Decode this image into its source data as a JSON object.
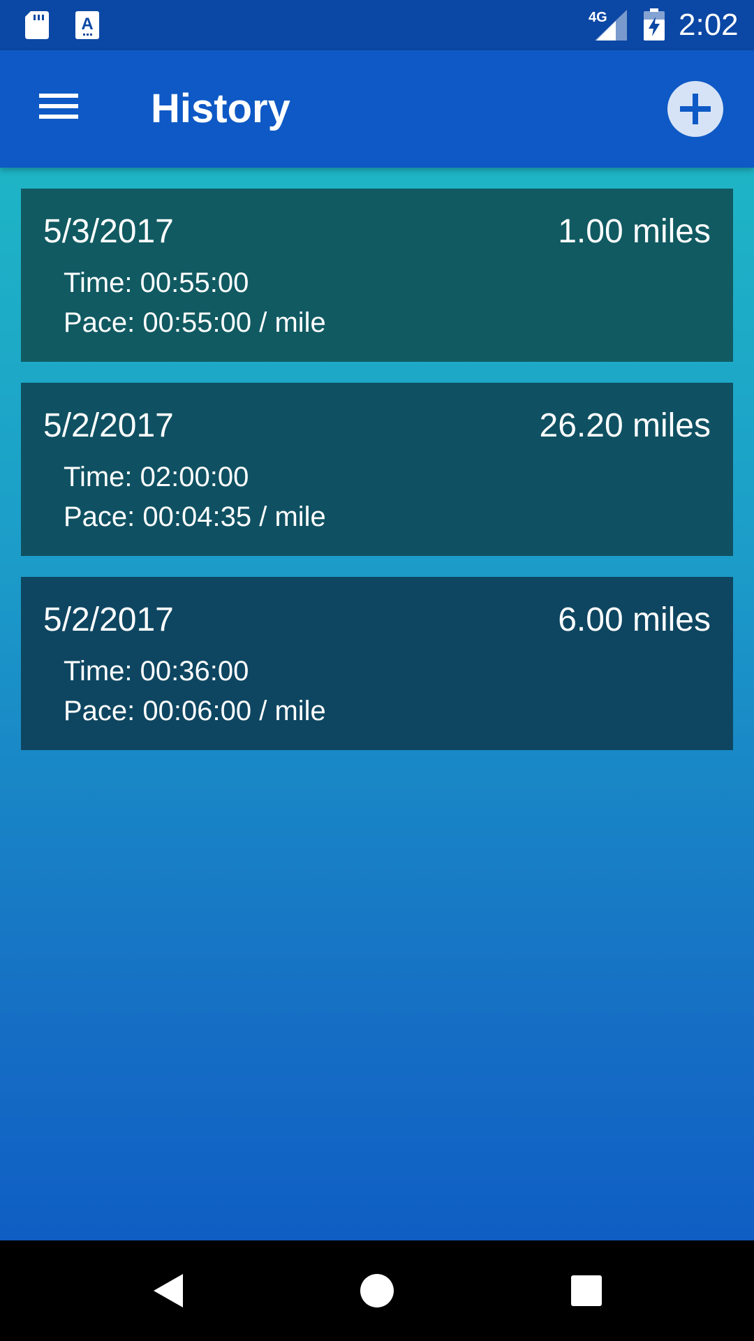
{
  "status_bar": {
    "network_type": "4G",
    "clock": "2:02",
    "icons": [
      "sd-card-icon",
      "font-icon",
      "signal-icon",
      "battery-charging-icon"
    ]
  },
  "app_bar": {
    "title": "History",
    "menu_icon": "hamburger-menu-icon",
    "add_icon": "plus-icon"
  },
  "history": [
    {
      "date": "5/3/2017",
      "distance": "1.00 miles",
      "time": "Time: 00:55:00",
      "pace": "Pace: 00:55:00 / mile",
      "card_color": "#115a62"
    },
    {
      "date": "5/2/2017",
      "distance": "26.20 miles",
      "time": "Time: 02:00:00",
      "pace": "Pace: 00:04:35 / mile",
      "card_color": "#0f5162"
    },
    {
      "date": "5/2/2017",
      "distance": "6.00 miles",
      "time": "Time: 00:36:00",
      "pace": "Pace: 00:06:00 / mile",
      "card_color": "#0e4661"
    }
  ],
  "nav_bar": {
    "icons": [
      "back-icon",
      "home-icon",
      "recent-apps-icon"
    ]
  },
  "colors": {
    "status_bar": "#0b47a4",
    "app_bar": "#0e59c5",
    "gradient_top": "#1fbfc4",
    "gradient_bottom": "#0c56c3",
    "add_button_bg": "#d6e3f6"
  }
}
